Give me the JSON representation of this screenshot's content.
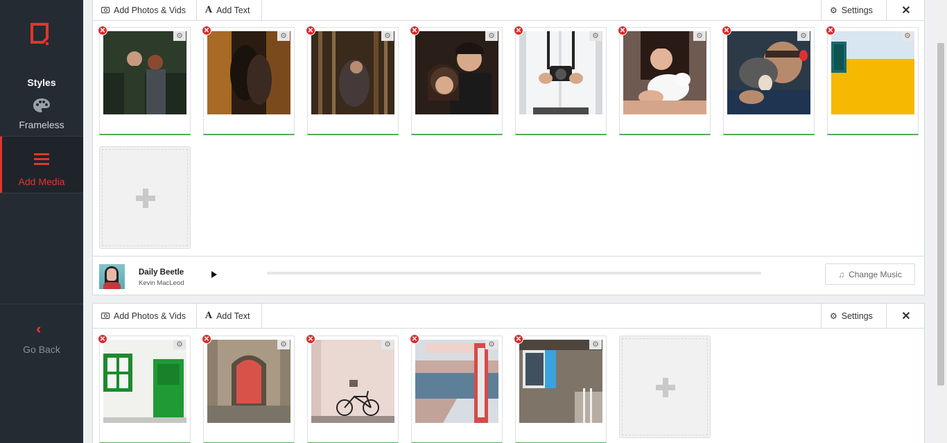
{
  "sidebar": {
    "styles_label": "Styles",
    "frameless_label": "Frameless",
    "add_media_label": "Add Media",
    "go_back_label": "Go Back",
    "accent_color": "#e3342f",
    "background_color": "#252b33"
  },
  "sections": [
    {
      "toolbar": {
        "add_photos_label": "Add Photos & Vids",
        "add_text_label": "Add Text",
        "settings_label": "Settings",
        "close_glyph": "✕"
      },
      "media": [
        {
          "thumb": "couple-in-forest"
        },
        {
          "thumb": "couple-kissing-woods"
        },
        {
          "thumb": "couple-forest-shadows"
        },
        {
          "thumb": "couple-smiling-closeup"
        },
        {
          "thumb": "man-holding-camera"
        },
        {
          "thumb": "woman-with-cat"
        },
        {
          "thumb": "man-kissing-cat"
        },
        {
          "thumb": "yellow-wall-window"
        }
      ],
      "music": {
        "title": "Daily Beetle",
        "artist": "Kevin MacLeod",
        "change_label": "Change Music",
        "progress": 0
      }
    },
    {
      "toolbar": {
        "add_photos_label": "Add Photos & Vids",
        "add_text_label": "Add Text",
        "settings_label": "Settings",
        "close_glyph": "✕"
      },
      "media": [
        {
          "thumb": "green-door-white-wall"
        },
        {
          "thumb": "red-door-stone-arch"
        },
        {
          "thumb": "bicycle-pink-wall"
        },
        {
          "thumb": "red-doorframe-harbor"
        },
        {
          "thumb": "blue-shutter-wood-house"
        }
      ]
    }
  ]
}
